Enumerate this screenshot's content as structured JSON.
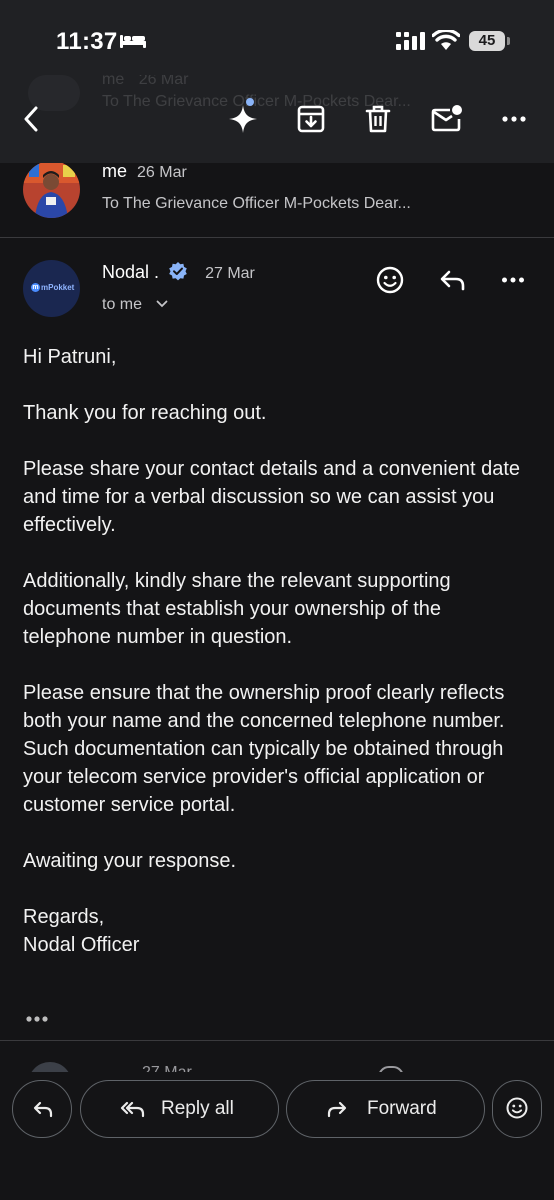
{
  "status_bar": {
    "time": "11:37",
    "battery": "45"
  },
  "toolbar": {
    "ghost_sender": "me",
    "ghost_date": "26 Mar",
    "ghost_snippet": "To The Grievance Officer M-Pockets Dear..."
  },
  "messages": [
    {
      "sender": "me",
      "date": "26 Mar",
      "snippet": "To The Grievance Officer M-Pockets Dear..."
    }
  ],
  "open_message": {
    "sender": "Nodal .",
    "date": "27 Mar",
    "recipient": "to me",
    "logo_text": "mPokket",
    "logo_mark": "m",
    "greeting": "Hi Patruni,",
    "paragraphs": [
      "Thank you for reaching out.",
      "Please share your contact details and a convenient date and time for a verbal discussion so we can assist you effectively.",
      "Additionally, kindly share the relevant supporting documents that establish your ownership of the telephone number in question.",
      "Please ensure that the ownership proof clearly reflects both your name and the concerned telephone number. Such documentation can typically be obtained through your telecom service provider's official application or customer service portal.",
      "Awaiting your response."
    ],
    "sign_off": "Regards,",
    "signature": "Nodal Officer"
  },
  "next_message": {
    "date": "27 Mar"
  },
  "actions": {
    "reply_all": "Reply all",
    "forward": "Forward"
  },
  "colors": {
    "background": "#141416",
    "header": "#202124",
    "verified_badge": "#8ab4f8",
    "logo_bg": "#1a2750"
  }
}
